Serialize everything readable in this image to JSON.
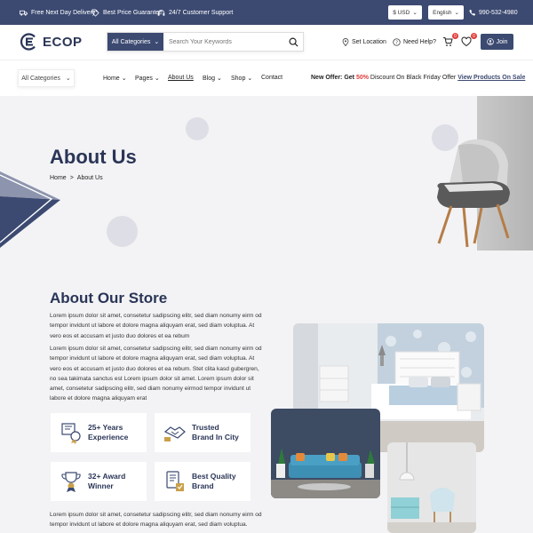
{
  "topbar": {
    "features": [
      "Free Next Day Delivery*",
      "Best Price Guarantee",
      "24/7 Customer Support"
    ],
    "currency": "$ USD",
    "language": "English",
    "phone": "990-532-4980"
  },
  "header": {
    "logo": "ECOP",
    "search_category": "All Categories",
    "search_placeholder": "Search Your Keywords",
    "set_location": "Set Location",
    "need_help": "Need Help?",
    "cart_count": "0",
    "wishlist_count": "0",
    "join": "Join"
  },
  "nav": {
    "all_categories": "All Categories",
    "items": [
      "Home",
      "Pages",
      "About Us",
      "Blog",
      "Shop",
      "Contact"
    ],
    "offer_prefix": "New Offer: Get ",
    "offer_pct": "50%",
    "offer_mid": " Discount On Black Friday Offer ",
    "offer_link": "View Products On Sale"
  },
  "hero": {
    "title": "About Us",
    "crumb_home": "Home",
    "crumb_sep": ">",
    "crumb_current": "About Us"
  },
  "store": {
    "title": "About Our Store",
    "para1": "Lorem ipsum dolor sit amet, consetetur sadipscing elitr, sed diam nonumy eirm od tempor invidunt ut labore et dolore magna aliquyam erat, sed diam voluptua. At vero eos et accusam et justo duo dolores et ea rebum",
    "para2": "Lorem ipsum dolor sit amet, consetetur sadipscing elitr, sed diam nonumy eirm od tempor invidunt ut labore et dolore magna aliquyam erat, sed diam voluptua. At vero eos et accusam et justo duo dolores et ea rebum. Stet clita kasd gubergren, no sea takimata sanctus est Lorem ipsum dolor sit amet. Lorem ipsum dolor sit amet, consetetur sadipscing elitr, sed diam nonumy eirmod tempor invidunt ut labore et dolore magna aliquyam erat",
    "features": [
      "25+ Years\nExperience",
      "Trusted\nBrand In City",
      "32+ Award\nWinner",
      "Best Quality\nBrand"
    ],
    "para3": "Lorem ipsum dolor sit amet, consetetur sadipscing elitr, sed diam nonumy eirm od tempor invidunt ut labore et dolore magna aliquyam erat, sed diam voluptua."
  },
  "colors": {
    "navy": "#3c4a72",
    "accent_red": "#e23b3b",
    "bg_light": "#f3f3f5"
  }
}
